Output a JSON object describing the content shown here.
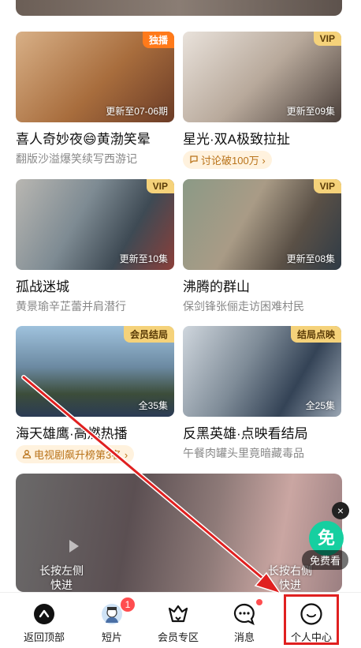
{
  "cards": [
    {
      "title": "喜人奇妙夜😄黄渤笑晕",
      "subtitle": "翻版沙溢爆笑续写西游记",
      "badge": "独播",
      "episode": "更新至07-06期"
    },
    {
      "title": "星光·双A极致拉扯",
      "pill": "讨论破100万",
      "badge": "VIP",
      "episode": "更新至09集"
    },
    {
      "title": "孤战迷城",
      "subtitle": "黄景瑜辛芷蕾并肩潜行",
      "badge": "VIP",
      "episode": "更新至10集"
    },
    {
      "title": "沸腾的群山",
      "subtitle": "保剑锋张俪走访困难村民",
      "badge": "VIP",
      "episode": "更新至08集"
    },
    {
      "title": "海天雄鹰·高燃热播",
      "pill": "电视剧飙升榜第3名",
      "badge": "会员结局",
      "episode": "全35集"
    },
    {
      "title": "反黑英雄·点映看结局",
      "subtitle": "午餐肉罐头里竟暗藏毒品",
      "badge": "结局点映",
      "episode": "全25集"
    }
  ],
  "feature": {
    "left_hint": "长按左侧\n快进",
    "right_hint": "长按右侧\n快进",
    "close": "×",
    "free_logo": "免",
    "free_label": "免费看"
  },
  "nav": {
    "items": [
      {
        "label": "返回顶部"
      },
      {
        "label": "短片",
        "badge": "1"
      },
      {
        "label": "会员专区"
      },
      {
        "label": "消息"
      },
      {
        "label": "个人中心"
      }
    ]
  },
  "icons": {
    "vip_pill": "chat-bubble-icon",
    "rank_pill": "person-icon"
  },
  "colors": {
    "accent_red": "#e02020",
    "vip_gold": "#f5d27a",
    "exclusive_orange": "#ff7a1a"
  }
}
